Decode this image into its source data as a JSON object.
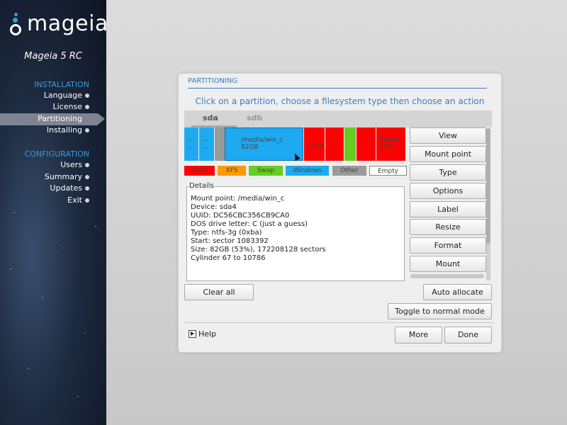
{
  "sidebar": {
    "logo_text": "mageia",
    "version": "Mageia 5 RC",
    "sections": [
      {
        "title": "INSTALLATION",
        "items": [
          "Language",
          "License",
          "Partitioning",
          "Installing"
        ]
      },
      {
        "title": "CONFIGURATION",
        "items": [
          "Users",
          "Summary",
          "Updates",
          "Exit"
        ]
      }
    ],
    "active_item": "Partitioning"
  },
  "dialog": {
    "title": "PARTITIONING",
    "instruction": "Click on a partition, choose a filesystem type then choose an action",
    "tabs": [
      "sda",
      "sdb"
    ],
    "active_tab": "sda",
    "partitions": [
      {
        "label": "...\n...",
        "color": "#1eaaf0"
      },
      {
        "label": "...\n...",
        "color": "#1eaaf0"
      },
      {
        "label": "",
        "color": "#9a9a9a"
      },
      {
        "label": "/media/win_c\n82GB",
        "color": "#1eaaf0"
      },
      {
        "label": "\n14GB",
        "color": "#ff0000"
      },
      {
        "label": "",
        "color": "#ff0000"
      },
      {
        "label": "",
        "color": "#66cc22"
      },
      {
        "label": "",
        "color": "#ff0000"
      },
      {
        "label": "/home\n25GB",
        "color": "#ff0000"
      }
    ],
    "legend": [
      {
        "label": "Ext4",
        "color": "#ff0000"
      },
      {
        "label": "XFS",
        "color": "#ff9900"
      },
      {
        "label": "Swap",
        "color": "#66cc22"
      },
      {
        "label": "Windows",
        "color": "#1eaaf0"
      },
      {
        "label": "Other",
        "color": "#9a9a9a"
      },
      {
        "label": "Empty",
        "color": "#ffffff"
      }
    ],
    "details": {
      "label": "Details",
      "lines": [
        "Mount point: /media/win_c",
        "Device: sda4",
        "UUID: DC56CBC356CB9CA0",
        "DOS drive letter: C (just a guess)",
        "Type: ntfs-3g (0xba)",
        "Start: sector 1083392",
        "Size: 82GB (53%), 172208128 sectors",
        "Cylinder 67 to 10786"
      ]
    },
    "actions": [
      "View",
      "Mount point",
      "Type",
      "Options",
      "Label",
      "Resize",
      "Format",
      "Mount"
    ],
    "clear_all": "Clear all",
    "auto_allocate": "Auto allocate",
    "toggle_mode": "Toggle to normal mode",
    "help": "Help",
    "more": "More",
    "done": "Done"
  }
}
